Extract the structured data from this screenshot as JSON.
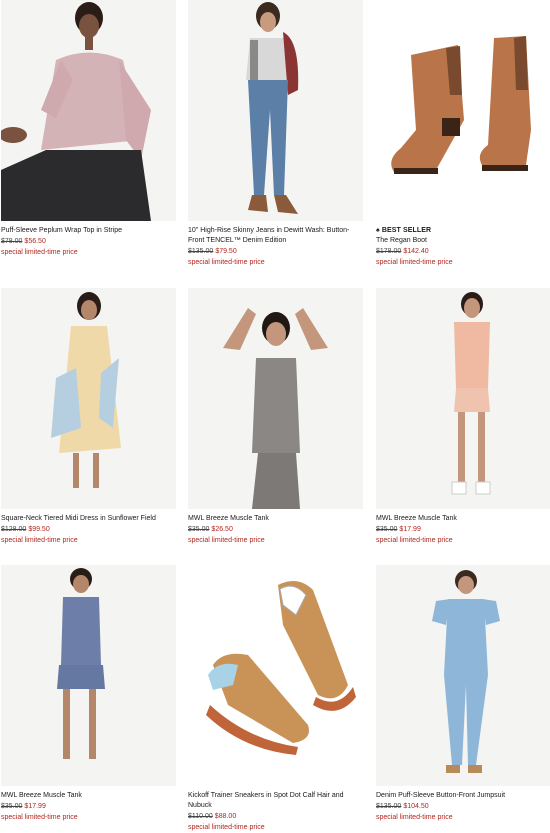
{
  "products": [
    {
      "name": "Puff-Sleeve Peplum Wrap Top in Stripe",
      "badge": "",
      "original_price": "$78.00",
      "sale_price": "$56.50",
      "promo": "special limited-time price"
    },
    {
      "name": "10\" High-Rise Skinny Jeans in Dewitt Wash: Button-Front TENCEL™ Denim Edition",
      "badge": "",
      "original_price": "$135.00",
      "sale_price": "$79.50",
      "promo": "special limited-time price"
    },
    {
      "name": "The Regan Boot",
      "badge": "BEST SELLER",
      "original_price": "$178.00",
      "sale_price": "$142.40",
      "promo": "special limited-time price"
    },
    {
      "name": "Square-Neck Tiered Midi Dress in Sunflower Field",
      "badge": "",
      "original_price": "$128.00",
      "sale_price": "$99.50",
      "promo": "special limited-time price"
    },
    {
      "name": "MWL Breeze Muscle Tank",
      "badge": "",
      "original_price": "$35.00",
      "sale_price": "$26.50",
      "promo": "special limited-time price"
    },
    {
      "name": "MWL Breeze Muscle Tank",
      "badge": "",
      "original_price": "$35.00",
      "sale_price": "$17.99",
      "promo": "special limited-time price"
    },
    {
      "name": "MWL Breeze Muscle Tank",
      "badge": "",
      "original_price": "$35.00",
      "sale_price": "$17.99",
      "promo": "special limited-time price"
    },
    {
      "name": "Kickoff Trainer Sneakers in Spot Dot Calf Hair and Nubuck",
      "badge": "",
      "original_price": "$110.00",
      "sale_price": "$88.00",
      "promo": "special limited-time price"
    },
    {
      "name": "Denim Puff-Sleeve Button-Front Jumpsuit",
      "badge": "",
      "original_price": "$135.00",
      "sale_price": "$104.50",
      "promo": "special limited-time price"
    }
  ],
  "icons": {
    "badge_icon": "flame-icon"
  },
  "colors": {
    "sale": "#b0271e",
    "image_bg": "#f3f3f1"
  }
}
